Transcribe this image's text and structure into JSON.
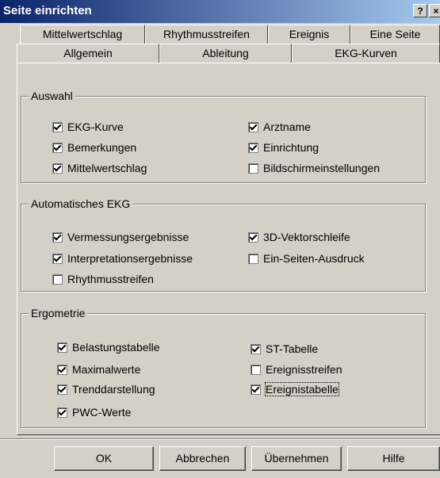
{
  "window": {
    "title": "Seite einrichten",
    "help_glyph": "?",
    "close_glyph": "×"
  },
  "tabs": {
    "row1": [
      "Mittelwertschlag",
      "Rhythmusstreifen",
      "Ereignis",
      "Eine Seite"
    ],
    "row2": [
      "Allgemein",
      "Ableitung",
      "EKG-Kurven"
    ]
  },
  "groups": {
    "auswahl": {
      "title": "Auswahl",
      "items": [
        {
          "label": "EKG-Kurve",
          "checked": true
        },
        {
          "label": "Arztname",
          "checked": true
        },
        {
          "label": "Bemerkungen",
          "checked": true
        },
        {
          "label": "Einrichtung",
          "checked": true
        },
        {
          "label": "Mittelwertschlag",
          "checked": true
        },
        {
          "label": "Bildschirmeinstellungen",
          "checked": false
        }
      ]
    },
    "auto_ekg": {
      "title": "Automatisches EKG",
      "items": [
        {
          "label": "Vermessungsergebnisse",
          "checked": true
        },
        {
          "label": "3D-Vektorschleife",
          "checked": true
        },
        {
          "label": "Interpretationsergebnisse",
          "checked": true
        },
        {
          "label": "Ein-Seiten-Ausdruck",
          "checked": false
        },
        {
          "label": "Rhythmusstreifen",
          "checked": false
        }
      ]
    },
    "ergometrie": {
      "title": "Ergometrie",
      "items": [
        {
          "label": "Belastungstabelle",
          "checked": true
        },
        {
          "label": "ST-Tabelle",
          "checked": true
        },
        {
          "label": "Maximalwerte",
          "checked": true
        },
        {
          "label": "Ereignisstreifen",
          "checked": false
        },
        {
          "label": "Trenddarstellung",
          "checked": true
        },
        {
          "label": "Ereignistabelle",
          "checked": true
        },
        {
          "label": "PWC-Werte",
          "checked": true
        }
      ]
    }
  },
  "buttons": {
    "ok": "OK",
    "cancel": "Abbrechen",
    "apply": "Übernehmen",
    "help": "Hilfe"
  }
}
